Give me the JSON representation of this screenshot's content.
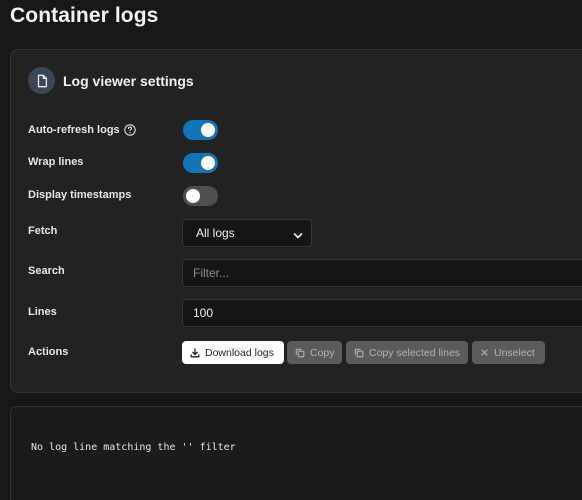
{
  "page": {
    "title": "Container logs"
  },
  "settings": {
    "title": "Log viewer settings",
    "icon": "file-icon",
    "auto_refresh": {
      "label": "Auto-refresh logs",
      "enabled": true,
      "help_icon": "question-circle-icon"
    },
    "wrap_lines": {
      "label": "Wrap lines",
      "enabled": true
    },
    "display_timestamps": {
      "label": "Display timestamps",
      "enabled": false
    },
    "fetch": {
      "label": "Fetch",
      "selected": "All logs",
      "icon": "chevron-down-icon"
    },
    "search": {
      "label": "Search",
      "placeholder": "Filter...",
      "value": ""
    },
    "lines": {
      "label": "Lines",
      "value": "100"
    },
    "actions": {
      "label": "Actions",
      "download": {
        "label": "Download logs",
        "icon": "download-icon"
      },
      "copy": {
        "label": "Copy",
        "icon": "copy-icon"
      },
      "copy_selected": {
        "label": "Copy selected lines",
        "icon": "copy-icon"
      },
      "unselect": {
        "label": "Unselect",
        "icon": "x-icon"
      }
    }
  },
  "log_viewer": {
    "message": "No log line matching the '' filter"
  },
  "colors": {
    "accent": "#1474b8",
    "background": "#171717",
    "card": "#222222"
  }
}
